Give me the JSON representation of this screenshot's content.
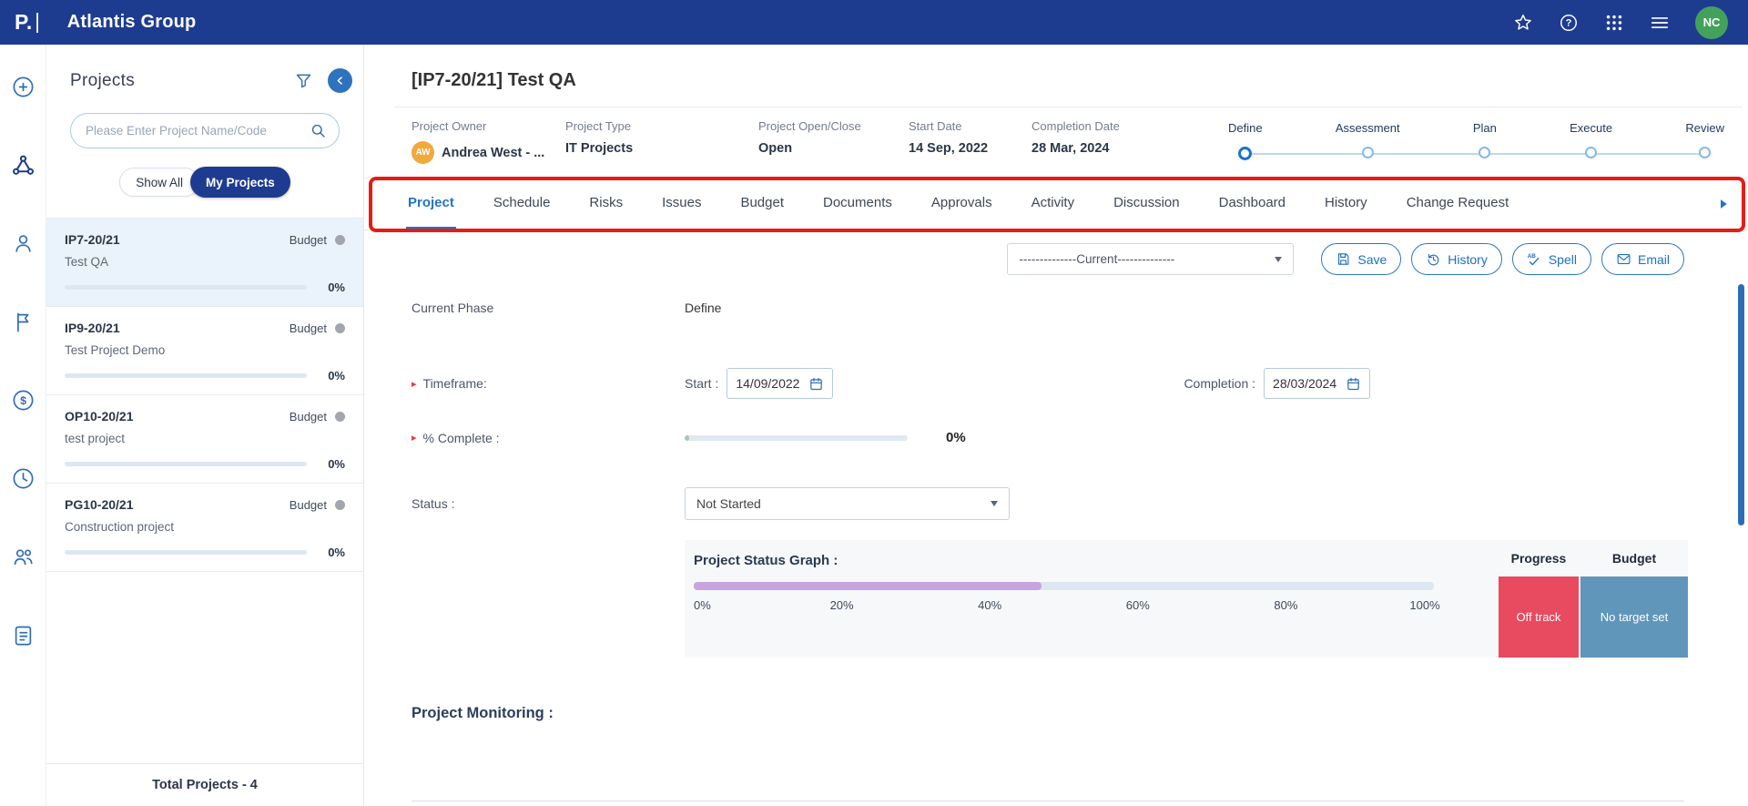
{
  "colors": {
    "brand-navy": "#1e3c8f",
    "accent-blue": "#2273c4",
    "phase-active-blue": "#1b74c9",
    "annotation-red": "#e41d15",
    "offtrack-red": "#e84a5f",
    "notarget-blue": "#6096ba",
    "bar-purple": "#c7a4de",
    "avatar-green": "#42a25c",
    "avatar-orange": "#f2a93b"
  },
  "topbar": {
    "logo": "P.",
    "title": "Atlantis Group",
    "avatar_initials": "NC"
  },
  "sidebar": {
    "heading": "Projects",
    "search_placeholder": "Please Enter Project Name/Code",
    "show_all_label": "Show All",
    "my_projects_label": "My Projects",
    "projects": [
      {
        "code": "IP7-20/21",
        "tag": "Budget",
        "name": "Test QA",
        "percent": "0%",
        "progress": 0,
        "selected": true
      },
      {
        "code": "IP9-20/21",
        "tag": "Budget",
        "name": "Test Project Demo",
        "percent": "0%",
        "progress": 0
      },
      {
        "code": "OP10-20/21",
        "tag": "Budget",
        "name": "test project",
        "percent": "0%",
        "progress": 0
      },
      {
        "code": "PG10-20/21",
        "tag": "Budget",
        "name": "Construction project",
        "percent": "0%",
        "progress": 0
      }
    ],
    "footer_text": "Total Projects - 4"
  },
  "project_header": {
    "title": "[IP7-20/21] Test QA",
    "fields": [
      {
        "label": "Project Owner",
        "value": "Andrea West - ...",
        "avatar": "AW"
      },
      {
        "label": "Project Type",
        "value": "IT Projects"
      },
      {
        "label": "Project Open/Close",
        "value": "Open"
      },
      {
        "label": "Start Date",
        "value": "14 Sep, 2022"
      },
      {
        "label": "Completion Date",
        "value": "28 Mar, 2024"
      }
    ],
    "phases": [
      {
        "label": "Define",
        "active": true
      },
      {
        "label": "Assessment"
      },
      {
        "label": "Plan"
      },
      {
        "label": "Execute"
      },
      {
        "label": "Review"
      }
    ]
  },
  "tabs": [
    {
      "label": "Project",
      "active": true
    },
    {
      "label": "Schedule"
    },
    {
      "label": "Risks"
    },
    {
      "label": "Issues"
    },
    {
      "label": "Budget"
    },
    {
      "label": "Documents"
    },
    {
      "label": "Approvals"
    },
    {
      "label": "Activity"
    },
    {
      "label": "Discussion"
    },
    {
      "label": "Dashboard"
    },
    {
      "label": "History"
    },
    {
      "label": "Change Request"
    }
  ],
  "toolbar": {
    "version_selected": "--------------Current--------------",
    "save_label": "Save",
    "history_label": "History",
    "spell_label": "Spell",
    "email_label": "Email"
  },
  "form": {
    "current_phase_label": "Current Phase",
    "current_phase_value": "Define",
    "timeframe_label": "Timeframe:",
    "start_label": "Start :",
    "start_value": "14/09/2022",
    "completion_label": "Completion :",
    "completion_value": "28/03/2024",
    "percent_complete_label": "% Complete :",
    "percent_complete_value": "0%",
    "status_label": "Status :",
    "status_value": "Not Started"
  },
  "status_graph": {
    "title": "Project Status Graph :",
    "bar_percent": 47,
    "scale": [
      "0%",
      "20%",
      "40%",
      "60%",
      "80%",
      "100%"
    ],
    "progress_header": "Progress",
    "budget_header": "Budget",
    "progress_value": "Off track",
    "budget_value": "No target set"
  },
  "monitoring_heading": "Project Monitoring :"
}
